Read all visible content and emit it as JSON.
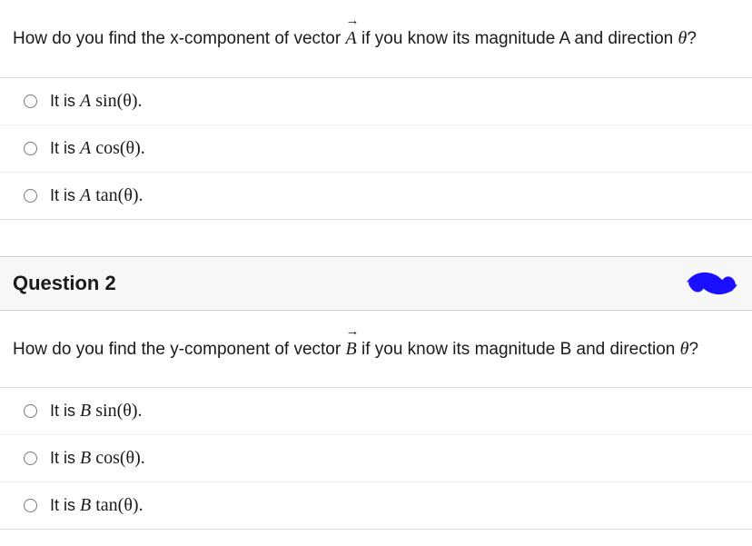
{
  "q1": {
    "stem_pre": "How do you find the x-component of vector ",
    "vec_letter": "A",
    "stem_post": " if you know its magnitude A and direction ",
    "theta": "θ",
    "qmark": "?",
    "options": [
      {
        "prefix": "It is ",
        "var": "A",
        "func": " sin(θ)."
      },
      {
        "prefix": "It is ",
        "var": "A",
        "func": " cos(θ)."
      },
      {
        "prefix": "It is ",
        "var": "A",
        "func": " tan(θ)."
      }
    ]
  },
  "q2": {
    "header": "Question 2",
    "stem_pre": "How do you find the y-component of vector ",
    "vec_letter": "B",
    "stem_post": " if you know its magnitude B and direction ",
    "theta": "θ",
    "qmark": "?",
    "options": [
      {
        "prefix": "It is ",
        "var": "B",
        "func": " sin(θ)."
      },
      {
        "prefix": "It is ",
        "var": "B",
        "func": " cos(θ)."
      },
      {
        "prefix": "It is ",
        "var": "B",
        "func": " tan(θ)."
      }
    ]
  }
}
